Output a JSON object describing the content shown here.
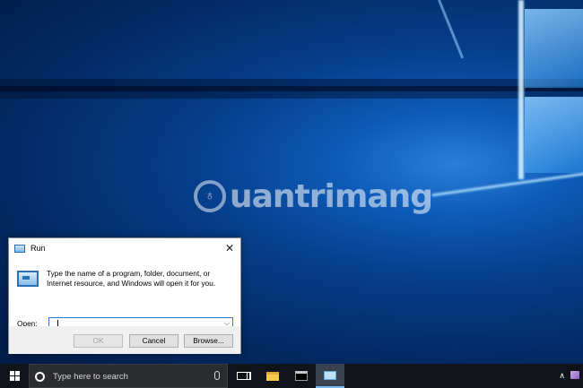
{
  "watermark": {
    "text": "uantrimang",
    "glyph": "♁"
  },
  "run_dialog": {
    "title": "Run",
    "description": "Type the name of a program, folder, document, or Internet resource, and Windows will open it for you.",
    "open_label": "Open:",
    "open_value": "",
    "buttons": {
      "ok": "OK",
      "cancel": "Cancel",
      "browse": "Browse..."
    },
    "close_glyph": "✕",
    "dropdown_glyph": "⌵"
  },
  "taskbar": {
    "search_placeholder": "Type here to search",
    "tray_up_glyph": "∧",
    "icons": [
      "windows-logo-icon",
      "cortana-icon",
      "mic-icon",
      "task-view-icon",
      "file-explorer-icon",
      "command-prompt-icon",
      "run-icon",
      "network-icon"
    ]
  },
  "colors": {
    "accent": "#2b7bd6",
    "taskbar": "#101418",
    "dialog_body": "#ffffff",
    "dialog_footer": "#f0f0f0"
  }
}
